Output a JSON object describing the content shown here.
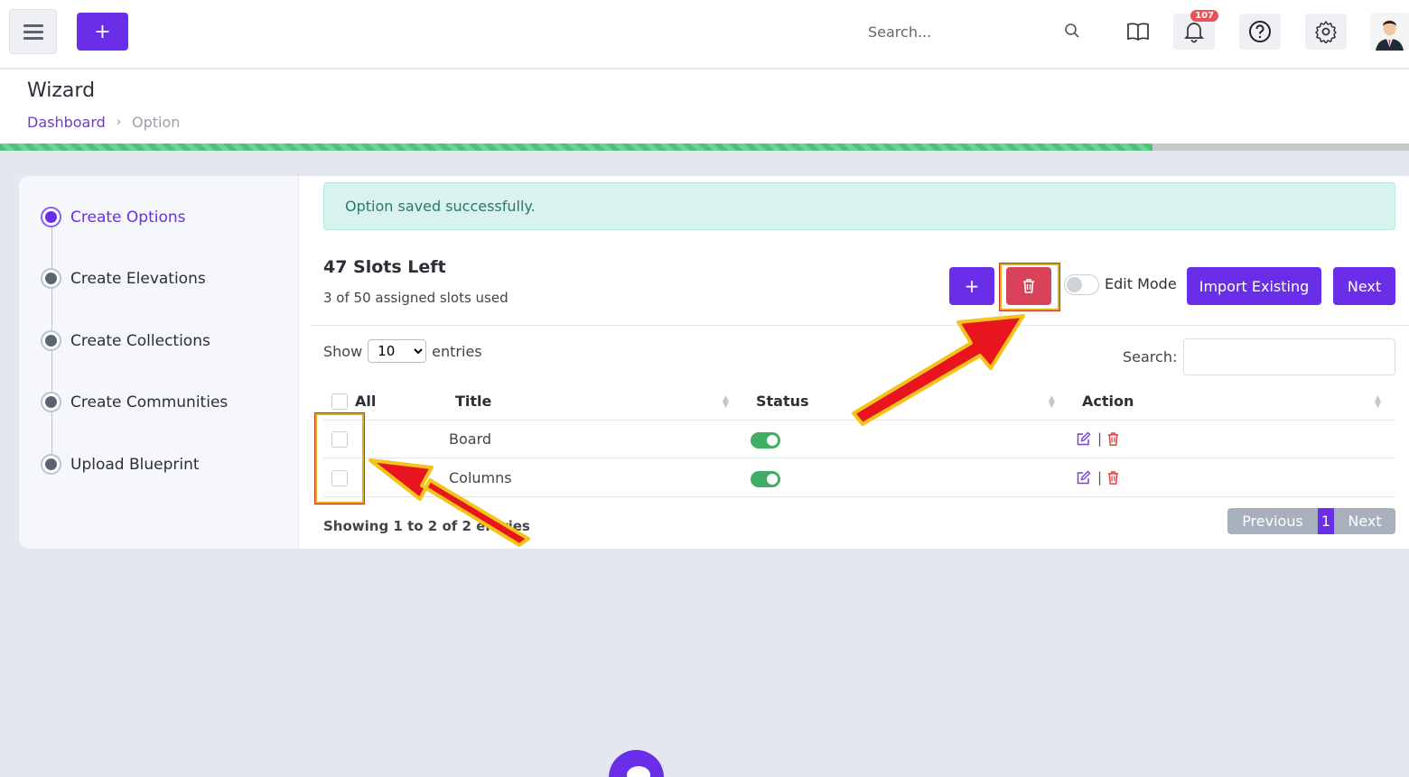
{
  "topbar": {
    "add_label": "+",
    "search_placeholder": "Search...",
    "notification_count": "107"
  },
  "header": {
    "title": "Wizard",
    "breadcrumb": [
      "Dashboard",
      "Option"
    ]
  },
  "progress": {
    "fraction": 0.818
  },
  "steps": [
    {
      "label": "Create Options",
      "active": true
    },
    {
      "label": "Create Elevations",
      "active": false
    },
    {
      "label": "Create Collections",
      "active": false
    },
    {
      "label": "Create Communities",
      "active": false
    },
    {
      "label": "Upload Blueprint",
      "active": false
    }
  ],
  "alert": "Option saved successfully.",
  "slots": {
    "title": "47 Slots Left",
    "subtitle": "3 of 50 assigned slots used"
  },
  "toolbar": {
    "add_label": "+",
    "edit_mode_label": "Edit Mode",
    "import_label": "Import Existing",
    "next_label": "Next"
  },
  "table_controls": {
    "show_label": "Show",
    "entries_value": "10",
    "entries_label": "entries",
    "search_label": "Search:"
  },
  "table": {
    "headers": [
      "All",
      "Title",
      "Status",
      "Action"
    ],
    "rows": [
      {
        "title": "Board",
        "status": true
      },
      {
        "title": "Columns",
        "status": true
      }
    ],
    "action_separator": "|"
  },
  "footer": {
    "showing": "Showing 1 to 2 of 2 entries",
    "prev_label": "Previous",
    "page": "1",
    "next_label": "Next"
  },
  "colors": {
    "accent": "#6a2ee8",
    "danger": "#d9435a",
    "success": "#3fae64",
    "arrow": "#e8141e",
    "arrow_outline": "#f3c51a"
  }
}
